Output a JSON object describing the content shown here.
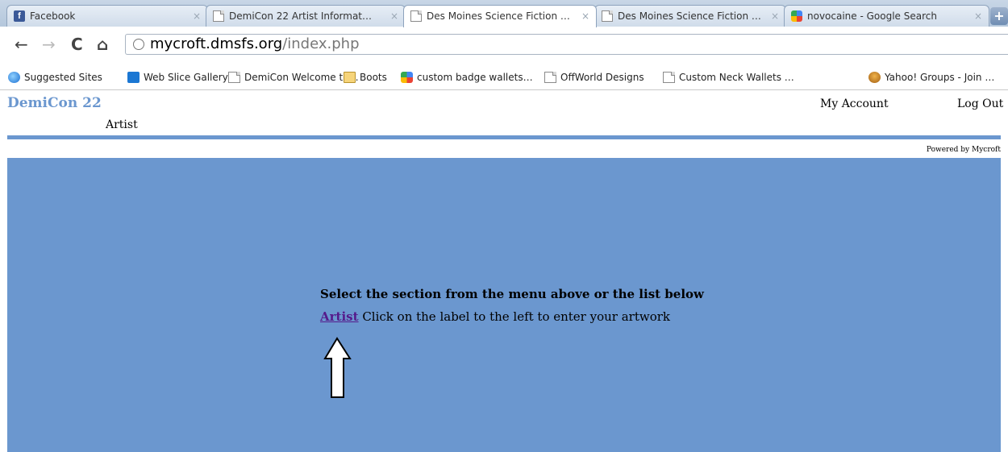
{
  "browser": {
    "tabs": [
      {
        "label": "Facebook",
        "icon": "facebook-icon",
        "close": "×"
      },
      {
        "label": "DemiCon 22 Artist Informat…",
        "icon": "page-icon",
        "close": "×"
      },
      {
        "label": "Des Moines Science Fiction …",
        "icon": "page-icon",
        "close": "×",
        "active": true
      },
      {
        "label": "Des Moines Science Fiction …",
        "icon": "page-icon",
        "close": "×"
      },
      {
        "label": "novocaine - Google Search",
        "icon": "google-icon",
        "close": "×"
      }
    ],
    "new_tab": "+",
    "nav": {
      "back": "←",
      "forward": "→",
      "reload": "C",
      "home": "⌂"
    },
    "address": {
      "host": "mycroft.dmsfs.org",
      "path": "/index.php"
    },
    "bookmarks": [
      {
        "label": "Suggested Sites",
        "icon": "ie-icon"
      },
      {
        "label": "Web Slice Gallery",
        "icon": "web-slice-icon"
      },
      {
        "label": "DemiCon Welcome te…",
        "icon": "page-icon"
      },
      {
        "label": "Boots",
        "icon": "folder-icon"
      },
      {
        "label": "custom badge wallets…",
        "icon": "google-icon"
      },
      {
        "label": "OffWorld Designs",
        "icon": "page-icon"
      },
      {
        "label": "Custom Neck Wallets …",
        "icon": "page-icon"
      },
      {
        "label": "Yahoo! Groups - Join …",
        "icon": "yahoo-groups-icon"
      }
    ]
  },
  "page": {
    "site_title": "DemiCon 22",
    "header_links": {
      "account": "My Account",
      "logout": "Log Out"
    },
    "submenu": "Artist",
    "powered_by": "Powered by Mycroft",
    "heading": "Select the section from the menu above or the list below",
    "section_link": "Artist",
    "section_desc": "Click on the label to the left to enter your artwork",
    "accent_color": "#6b97cf",
    "link_color": "#551a8b"
  }
}
